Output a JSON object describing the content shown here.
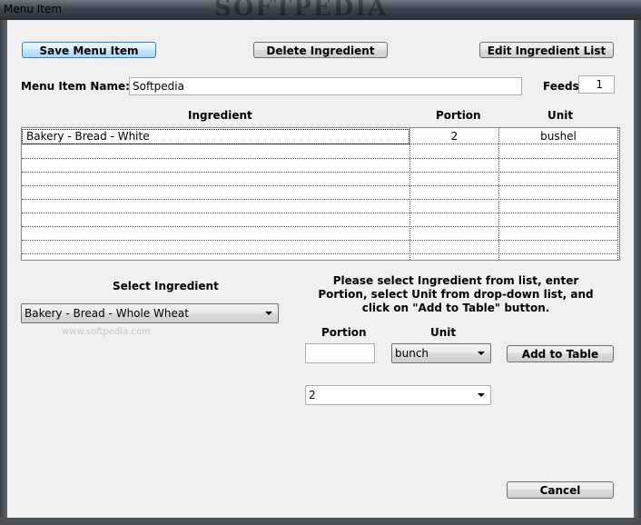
{
  "window": {
    "title": "Menu Item",
    "watermark": "SOFTPEDIA"
  },
  "toolbar": {
    "save_label": "Save Menu Item",
    "delete_label": "Delete Ingredient",
    "edit_list_label": "Edit Ingredient List"
  },
  "form": {
    "name_label": "Menu Item Name:",
    "name_value": "Softpedia",
    "feeds_label": "Feeds:",
    "feeds_value": "1"
  },
  "table": {
    "columns": [
      "Ingredient",
      "Portion",
      "Unit"
    ],
    "rows": [
      {
        "ingredient": "Bakery - Bread - White",
        "portion": "2",
        "unit": "bushel"
      }
    ]
  },
  "select_section": {
    "label": "Select Ingredient",
    "selected": "Bakery - Bread - Whole Wheat",
    "faint_text": "www.softpedia.com"
  },
  "add_section": {
    "instructions": "Please select Ingredient from list, enter Portion, select Unit from drop-down list, and click on \"Add to Table\" button.",
    "portion_label": "Portion",
    "unit_label": "Unit",
    "portion_value": "",
    "unit_selected": "bunch",
    "add_label": "Add to Table",
    "portion_combo_value": "2"
  },
  "footer": {
    "cancel_label": "Cancel"
  }
}
